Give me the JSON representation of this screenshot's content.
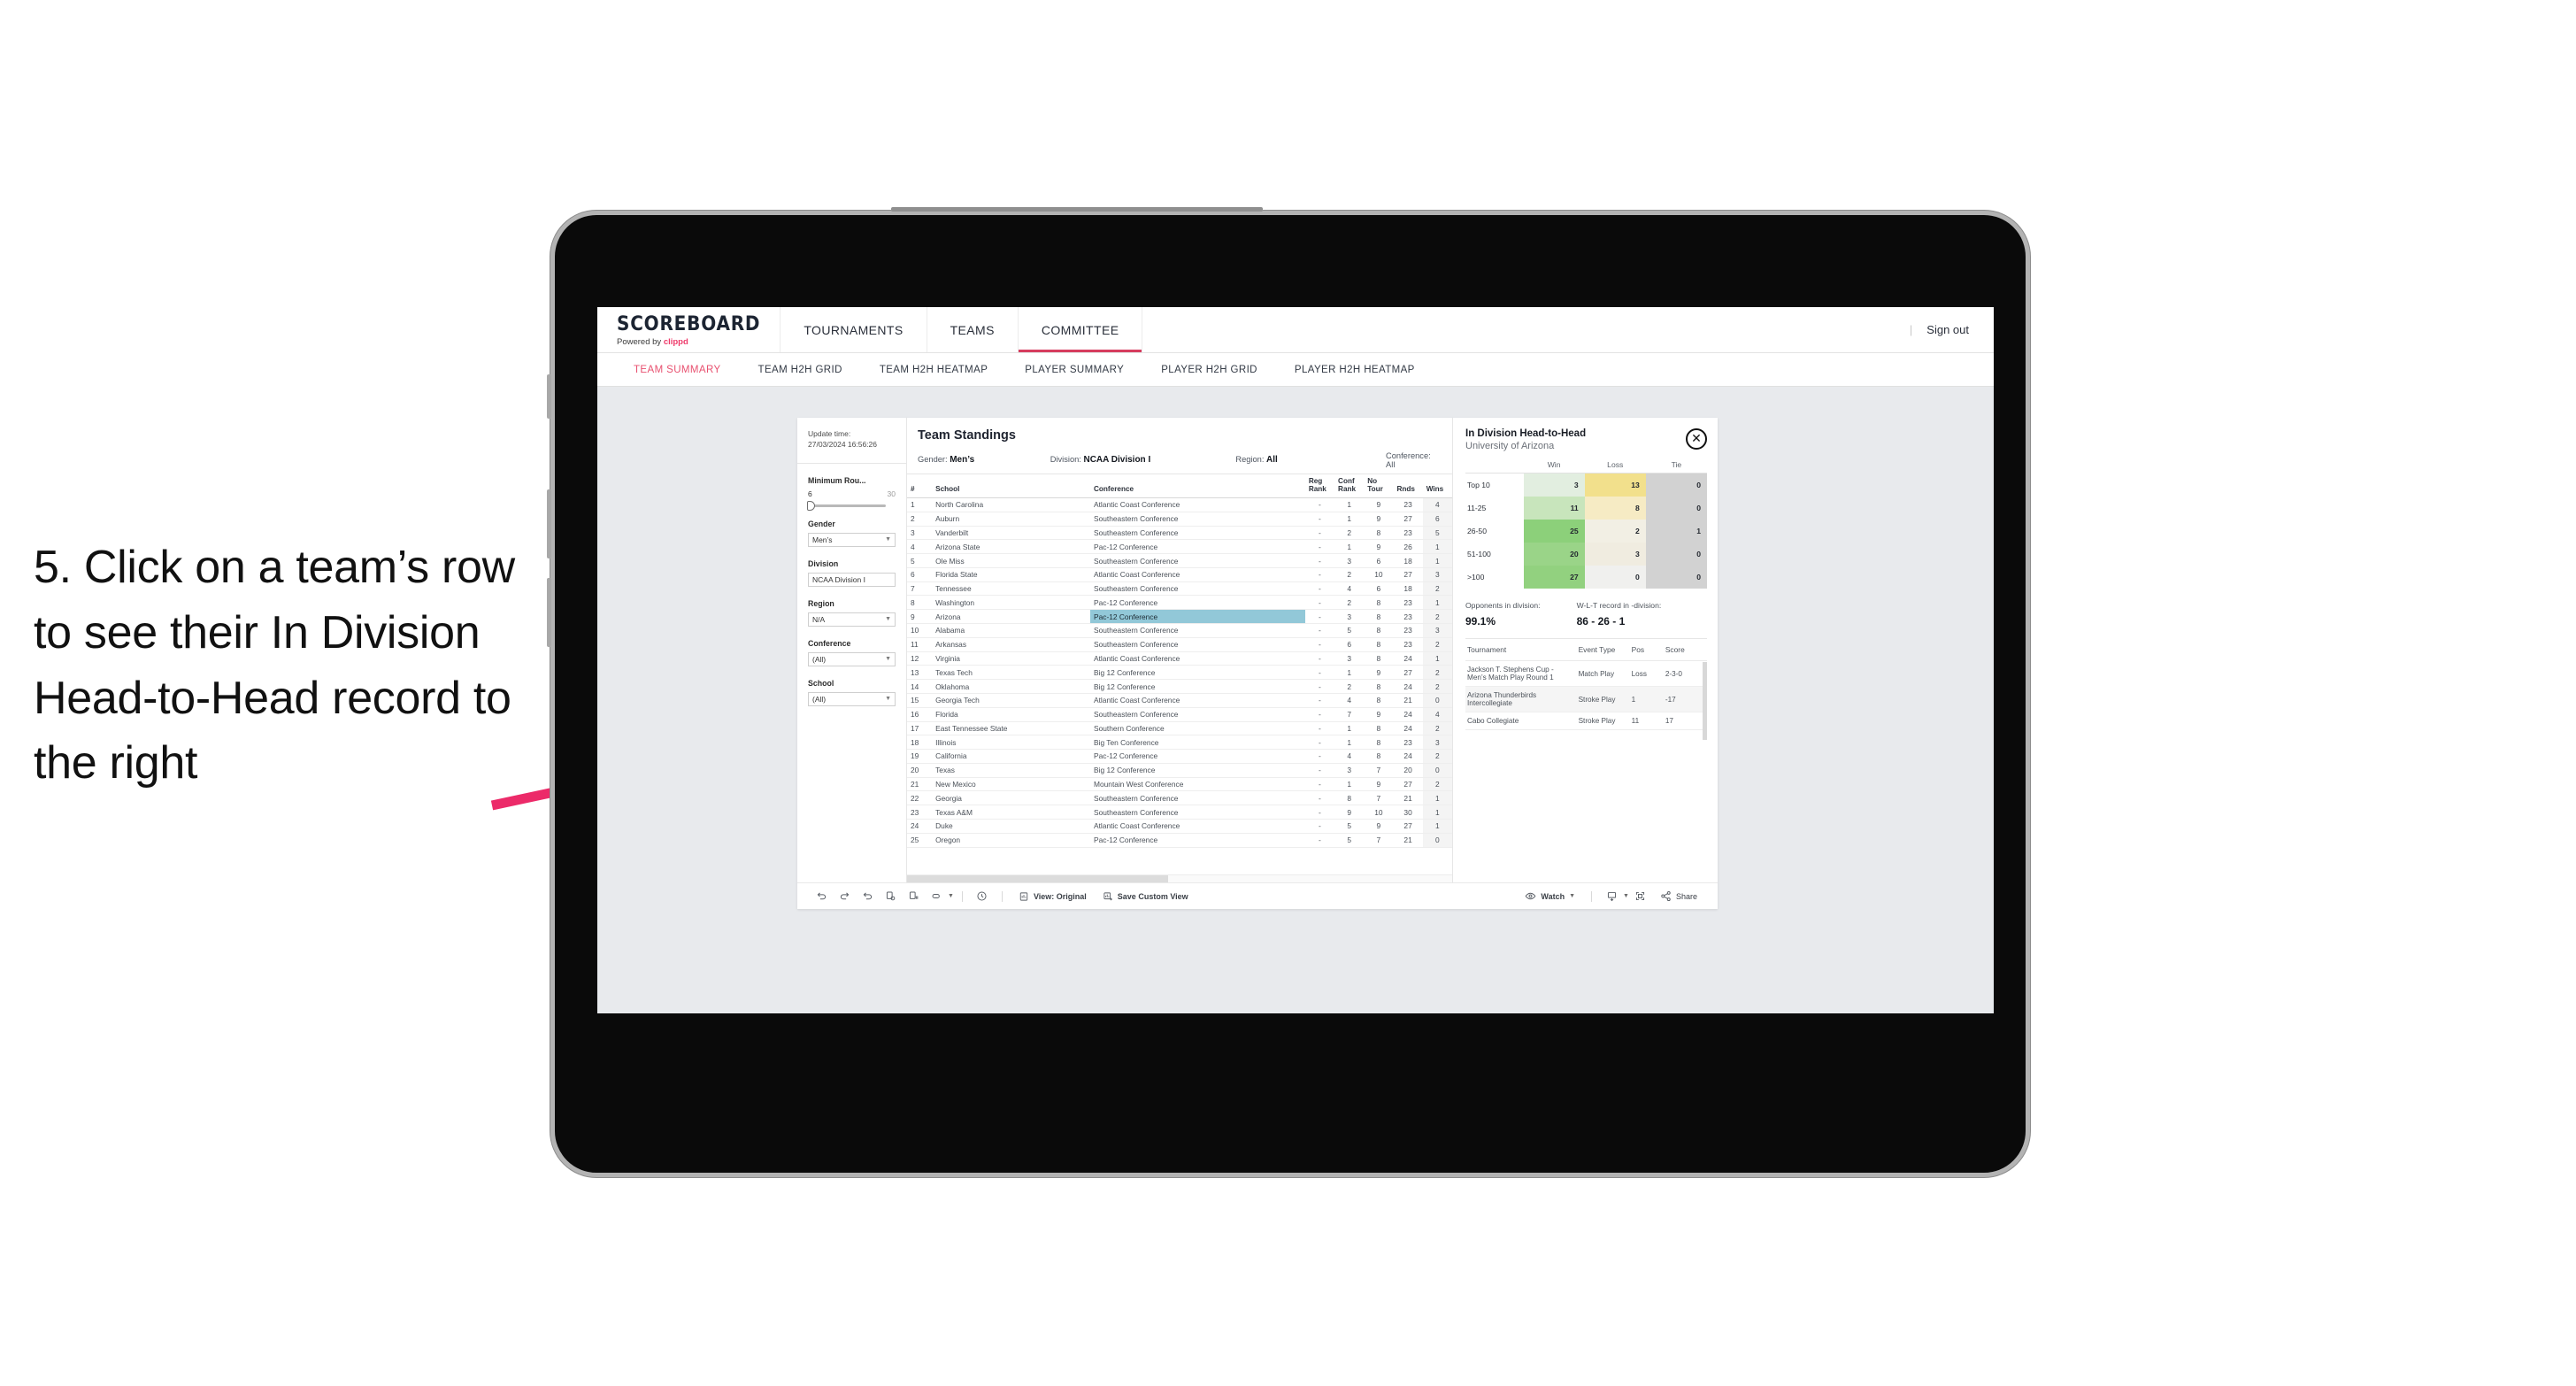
{
  "annotation": {
    "text": "5. Click on a team’s row to see their In Division Head-to-Head record to the right",
    "arrow_color": "#ec2a69"
  },
  "topnav": {
    "brand": {
      "title": "SCOREBOARD",
      "powered_prefix": "Powered by ",
      "powered_brand": "clippd"
    },
    "tabs": [
      {
        "label": "TOURNAMENTS",
        "active": false
      },
      {
        "label": "TEAMS",
        "active": false
      },
      {
        "label": "COMMITTEE",
        "active": true
      }
    ],
    "separator": "|",
    "signout": "Sign out"
  },
  "subnav": {
    "tabs": [
      {
        "label": "TEAM SUMMARY",
        "active": true
      },
      {
        "label": "TEAM H2H GRID",
        "active": false
      },
      {
        "label": "TEAM H2H HEATMAP",
        "active": false
      },
      {
        "label": "PLAYER SUMMARY",
        "active": false
      },
      {
        "label": "PLAYER H2H GRID",
        "active": false
      },
      {
        "label": "PLAYER H2H HEATMAP",
        "active": false
      }
    ]
  },
  "rail": {
    "update_label": "Update time:",
    "update_value": "27/03/2024 16:56:26",
    "slider": {
      "label": "Minimum Rou...",
      "min": "6",
      "max": "30"
    },
    "filters": [
      {
        "label": "Gender",
        "value": "Men’s"
      },
      {
        "label": "Division",
        "value": "NCAA Division I"
      },
      {
        "label": "Region",
        "value": "N/A"
      },
      {
        "label": "Conference",
        "value": "(All)"
      },
      {
        "label": "School",
        "value": "(All)"
      }
    ]
  },
  "standings": {
    "title": "Team Standings",
    "filter_bar": [
      {
        "label": "Gender:",
        "value": "Men’s"
      },
      {
        "label": "Division:",
        "value": "NCAA Division I"
      },
      {
        "label": "Region:",
        "value": "All"
      },
      {
        "label": "Conference:",
        "value": "All"
      }
    ],
    "columns": [
      "#",
      "School",
      "Conference",
      "Reg Rank",
      "Conf Rank",
      "No Tour",
      "Rnds",
      "Wins"
    ],
    "rows": [
      {
        "rank": "1",
        "school": "North Carolina",
        "conference": "Atlantic Coast Conference",
        "reg_rank": "-",
        "conf_rank": "1",
        "no_tour": "9",
        "rnds": "23",
        "wins": "4"
      },
      {
        "rank": "2",
        "school": "Auburn",
        "conference": "Southeastern Conference",
        "reg_rank": "-",
        "conf_rank": "1",
        "no_tour": "9",
        "rnds": "27",
        "wins": "6"
      },
      {
        "rank": "3",
        "school": "Vanderbilt",
        "conference": "Southeastern Conference",
        "reg_rank": "-",
        "conf_rank": "2",
        "no_tour": "8",
        "rnds": "23",
        "wins": "5"
      },
      {
        "rank": "4",
        "school": "Arizona State",
        "conference": "Pac-12 Conference",
        "reg_rank": "-",
        "conf_rank": "1",
        "no_tour": "9",
        "rnds": "26",
        "wins": "1"
      },
      {
        "rank": "5",
        "school": "Ole Miss",
        "conference": "Southeastern Conference",
        "reg_rank": "-",
        "conf_rank": "3",
        "no_tour": "6",
        "rnds": "18",
        "wins": "1"
      },
      {
        "rank": "6",
        "school": "Florida State",
        "conference": "Atlantic Coast Conference",
        "reg_rank": "-",
        "conf_rank": "2",
        "no_tour": "10",
        "rnds": "27",
        "wins": "3"
      },
      {
        "rank": "7",
        "school": "Tennessee",
        "conference": "Southeastern Conference",
        "reg_rank": "-",
        "conf_rank": "4",
        "no_tour": "6",
        "rnds": "18",
        "wins": "2"
      },
      {
        "rank": "8",
        "school": "Washington",
        "conference": "Pac-12 Conference",
        "reg_rank": "-",
        "conf_rank": "2",
        "no_tour": "8",
        "rnds": "23",
        "wins": "1"
      },
      {
        "rank": "9",
        "school": "Arizona",
        "conference": "Pac-12 Conference",
        "reg_rank": "-",
        "conf_rank": "3",
        "no_tour": "8",
        "rnds": "23",
        "wins": "2",
        "selected": true
      },
      {
        "rank": "10",
        "school": "Alabama",
        "conference": "Southeastern Conference",
        "reg_rank": "-",
        "conf_rank": "5",
        "no_tour": "8",
        "rnds": "23",
        "wins": "3"
      },
      {
        "rank": "11",
        "school": "Arkansas",
        "conference": "Southeastern Conference",
        "reg_rank": "-",
        "conf_rank": "6",
        "no_tour": "8",
        "rnds": "23",
        "wins": "2"
      },
      {
        "rank": "12",
        "school": "Virginia",
        "conference": "Atlantic Coast Conference",
        "reg_rank": "-",
        "conf_rank": "3",
        "no_tour": "8",
        "rnds": "24",
        "wins": "1"
      },
      {
        "rank": "13",
        "school": "Texas Tech",
        "conference": "Big 12 Conference",
        "reg_rank": "-",
        "conf_rank": "1",
        "no_tour": "9",
        "rnds": "27",
        "wins": "2"
      },
      {
        "rank": "14",
        "school": "Oklahoma",
        "conference": "Big 12 Conference",
        "reg_rank": "-",
        "conf_rank": "2",
        "no_tour": "8",
        "rnds": "24",
        "wins": "2"
      },
      {
        "rank": "15",
        "school": "Georgia Tech",
        "conference": "Atlantic Coast Conference",
        "reg_rank": "-",
        "conf_rank": "4",
        "no_tour": "8",
        "rnds": "21",
        "wins": "0"
      },
      {
        "rank": "16",
        "school": "Florida",
        "conference": "Southeastern Conference",
        "reg_rank": "-",
        "conf_rank": "7",
        "no_tour": "9",
        "rnds": "24",
        "wins": "4"
      },
      {
        "rank": "17",
        "school": "East Tennessee State",
        "conference": "Southern Conference",
        "reg_rank": "-",
        "conf_rank": "1",
        "no_tour": "8",
        "rnds": "24",
        "wins": "2"
      },
      {
        "rank": "18",
        "school": "Illinois",
        "conference": "Big Ten Conference",
        "reg_rank": "-",
        "conf_rank": "1",
        "no_tour": "8",
        "rnds": "23",
        "wins": "3"
      },
      {
        "rank": "19",
        "school": "California",
        "conference": "Pac-12 Conference",
        "reg_rank": "-",
        "conf_rank": "4",
        "no_tour": "8",
        "rnds": "24",
        "wins": "2"
      },
      {
        "rank": "20",
        "school": "Texas",
        "conference": "Big 12 Conference",
        "reg_rank": "-",
        "conf_rank": "3",
        "no_tour": "7",
        "rnds": "20",
        "wins": "0"
      },
      {
        "rank": "21",
        "school": "New Mexico",
        "conference": "Mountain West Conference",
        "reg_rank": "-",
        "conf_rank": "1",
        "no_tour": "9",
        "rnds": "27",
        "wins": "2"
      },
      {
        "rank": "22",
        "school": "Georgia",
        "conference": "Southeastern Conference",
        "reg_rank": "-",
        "conf_rank": "8",
        "no_tour": "7",
        "rnds": "21",
        "wins": "1"
      },
      {
        "rank": "23",
        "school": "Texas A&M",
        "conference": "Southeastern Conference",
        "reg_rank": "-",
        "conf_rank": "9",
        "no_tour": "10",
        "rnds": "30",
        "wins": "1"
      },
      {
        "rank": "24",
        "school": "Duke",
        "conference": "Atlantic Coast Conference",
        "reg_rank": "-",
        "conf_rank": "5",
        "no_tour": "9",
        "rnds": "27",
        "wins": "1"
      },
      {
        "rank": "25",
        "school": "Oregon",
        "conference": "Pac-12 Conference",
        "reg_rank": "-",
        "conf_rank": "5",
        "no_tour": "7",
        "rnds": "21",
        "wins": "0"
      }
    ]
  },
  "h2h": {
    "title": "In Division Head-to-Head",
    "subtitle": "University of Arizona",
    "close_glyph": "✕",
    "chart_data": {
      "type": "heatmap",
      "title": "In Division Head-to-Head",
      "subtitle": "University of Arizona",
      "columns": [
        "Win",
        "Loss",
        "Tie"
      ],
      "rows": [
        "Top 10",
        "11-25",
        "26-50",
        "51-100",
        ">100"
      ],
      "values": [
        [
          3,
          13,
          0
        ],
        [
          11,
          8,
          0
        ],
        [
          25,
          2,
          1
        ],
        [
          20,
          3,
          0
        ],
        [
          27,
          0,
          0
        ]
      ],
      "cell_colors": [
        [
          "#e2eee0",
          "#f2e08c",
          "#d2d2d2"
        ],
        [
          "#c8e5bc",
          "#f6ebc4",
          "#d2d2d2"
        ],
        [
          "#8cd07a",
          "#f2efe4",
          "#d2d2d2"
        ],
        [
          "#9ad488",
          "#f0ece0",
          "#d2d2d2"
        ],
        [
          "#92d17f",
          "#f0f0ee",
          "#d2d2d2"
        ]
      ]
    },
    "summary": [
      {
        "label": "Opponents in division:",
        "value": "99.1%"
      },
      {
        "label": "W-L-T record in -division:",
        "value": "86 - 26 - 1"
      }
    ],
    "tournament_columns": [
      "Tournament",
      "Event Type",
      "Pos",
      "Score"
    ],
    "tournaments": [
      {
        "name": "Jackson T. Stephens Cup - Men’s Match Play Round 1",
        "event_type": "Match Play",
        "pos": "Loss",
        "score": "2-3-0"
      },
      {
        "name": "Arizona Thunderbirds Intercollegiate",
        "event_type": "Stroke Play",
        "pos": "1",
        "score": "-17"
      },
      {
        "name": "Cabo Collegiate",
        "event_type": "Stroke Play",
        "pos": "11",
        "score": "17"
      }
    ]
  },
  "toolbar": {
    "icons": [
      "undo-icon",
      "redo-icon",
      "revert-icon",
      "refresh-data-icon",
      "pause-icon",
      "shape-icon"
    ],
    "view_label": "View: Original",
    "save_label": "Save Custom View",
    "watch_label": "Watch",
    "share_label": "Share"
  }
}
